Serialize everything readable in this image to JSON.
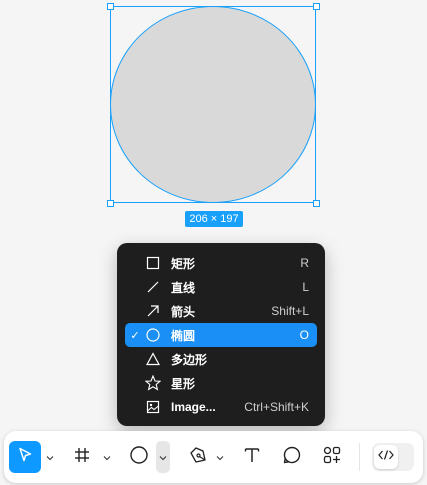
{
  "canvas": {
    "dimension_label": "206 × 197",
    "selection_color": "#18a0fb"
  },
  "shape_menu": {
    "items": [
      {
        "label": "矩形",
        "shortcut": "R",
        "icon": "rectangle-icon",
        "checked": false
      },
      {
        "label": "直线",
        "shortcut": "L",
        "icon": "line-icon",
        "checked": false
      },
      {
        "label": "箭头",
        "shortcut": "Shift+L",
        "icon": "arrow-icon",
        "checked": false
      },
      {
        "label": "椭圆",
        "shortcut": "O",
        "icon": "ellipse-icon",
        "checked": true
      },
      {
        "label": "多边形",
        "shortcut": "",
        "icon": "polygon-icon",
        "checked": false
      },
      {
        "label": "星形",
        "shortcut": "",
        "icon": "star-icon",
        "checked": false
      },
      {
        "label": "Image...",
        "shortcut": "Ctrl+Shift+K",
        "icon": "image-icon",
        "checked": false
      }
    ],
    "check_mark": "✓",
    "active_color": "#1a8ff5"
  },
  "toolbar": {
    "tools": [
      "move-tool",
      "frame-tool",
      "ellipse-tool",
      "pen-tool",
      "text-tool",
      "comment-tool",
      "actions-tool"
    ],
    "dev_mode": "dev-mode-toggle",
    "primary_color": "#0d99ff"
  }
}
